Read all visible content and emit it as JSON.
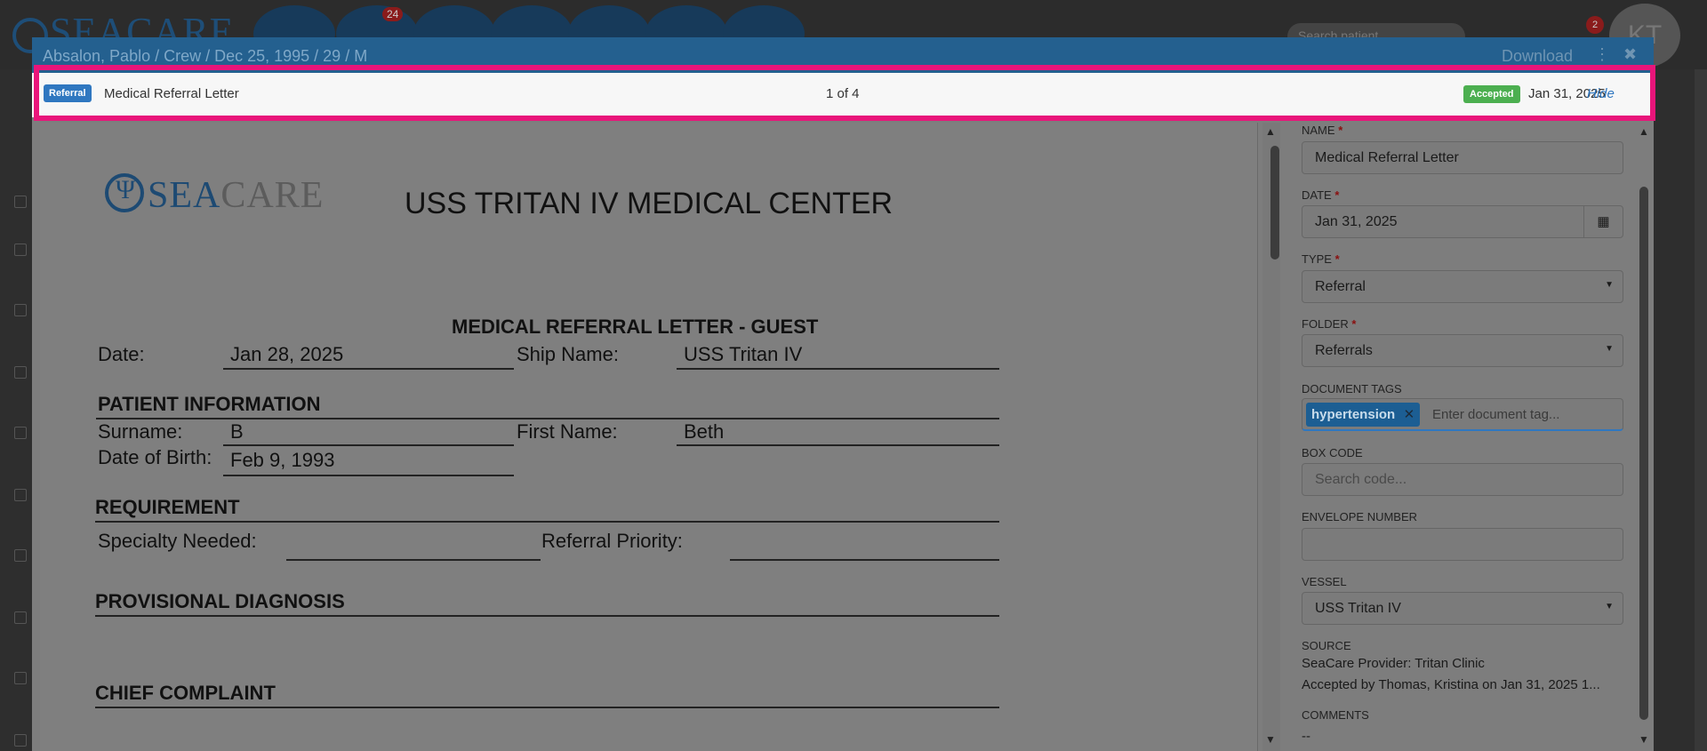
{
  "app": {
    "logo_text": "SEACARE",
    "nav_badge": "24",
    "search_placeholder": "Search patient",
    "notif_badge": "2",
    "avatar_initials": "KT"
  },
  "modal": {
    "title": "Absalon, Pablo / Crew / Dec 25, 1995 / 29 / M",
    "download_label": "Download",
    "kebab_icon": "⋮",
    "close_icon": "✖"
  },
  "info_bar": {
    "type_badge": "Referral",
    "doc_name": "Medical Referral Letter",
    "page_indicator": "1 of 4",
    "status_badge": "Accepted",
    "status_date": "Jan 31, 2025",
    "hide_label": "Hide"
  },
  "document": {
    "logo_sea": "SEA",
    "logo_care": "CARE",
    "title": "USS TRITAN IV MEDICAL CENTER",
    "subtitle": "MEDICAL REFERRAL LETTER - GUEST",
    "date_label": "Date:",
    "date_value": "Jan 28, 2025",
    "ship_label": "Ship Name:",
    "ship_value": "USS Tritan IV",
    "patient_heading": "PATIENT INFORMATION",
    "surname_label": "Surname:",
    "surname_value": "B",
    "firstname_label": "First Name:",
    "firstname_value": "Beth",
    "dob_label": "Date of Birth:",
    "dob_value": "Feb 9, 1993",
    "requirement_heading": "REQUIREMENT",
    "specialty_label": "Specialty Needed:",
    "priority_label": "Referral Priority:",
    "diagnosis_heading": "PROVISIONAL DIAGNOSIS",
    "complaint_heading": "CHIEF COMPLAINT"
  },
  "form": {
    "name_label": "NAME",
    "name_value": "Medical Referral Letter",
    "date_label": "DATE",
    "date_value": "Jan 31, 2025",
    "type_label": "TYPE",
    "type_value": "Referral",
    "folder_label": "FOLDER",
    "folder_value": "Referrals",
    "tags_label": "DOCUMENT TAGS",
    "tag_chip": "hypertension",
    "tag_placeholder": "Enter document tag...",
    "box_code_label": "BOX CODE",
    "box_code_placeholder": "Search code...",
    "envelope_label": "ENVELOPE NUMBER",
    "envelope_value": "",
    "vessel_label": "VESSEL",
    "vessel_value": "USS Tritan IV",
    "source_label": "SOURCE",
    "source_line1": "SeaCare Provider: Tritan Clinic",
    "source_line2": "Accepted by Thomas, Kristina on Jan 31, 2025 1...",
    "comments_label": "COMMENTS",
    "comments_value": "--",
    "required_mark": "*"
  },
  "colors": {
    "header": "#24608f",
    "highlight": "#e8157a",
    "referral_badge": "#2f77c0",
    "accepted_badge": "#4caf50"
  }
}
